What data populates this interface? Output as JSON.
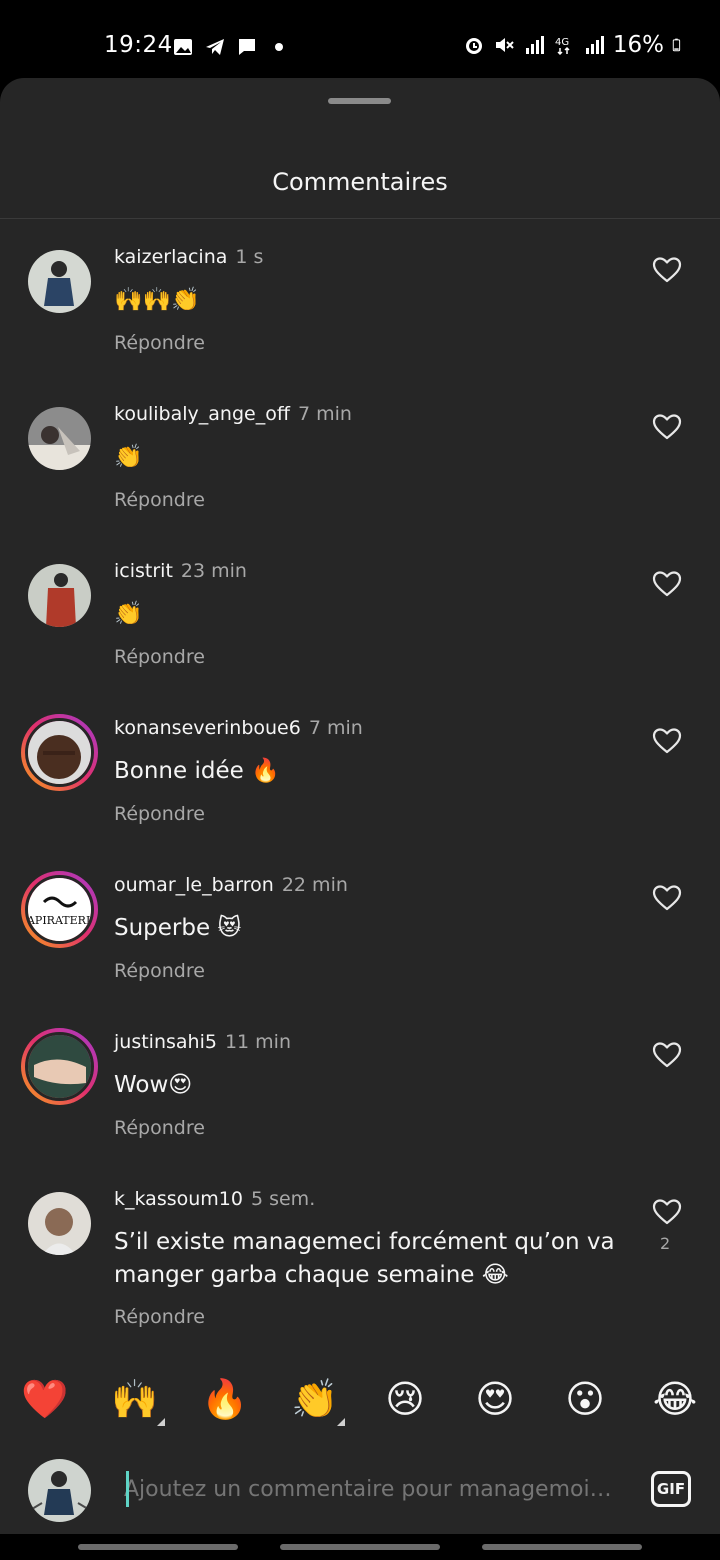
{
  "status_bar": {
    "time": "19:24",
    "left_icons": [
      "image-icon",
      "telegram-icon",
      "message-icon",
      "dot-icon"
    ],
    "right_icons": [
      "alarm-icon",
      "mute-icon",
      "signal-icon",
      "4g-icon",
      "signal-icon"
    ],
    "battery_label": "16%",
    "battery_level": 0.16
  },
  "sheet": {
    "title": "Commentaires"
  },
  "comments": [
    {
      "username": "kaizerlacina",
      "time": "1 s",
      "text": "🙌🙌👏",
      "reply_label": "Répondre",
      "likes": "",
      "story_ring": false
    },
    {
      "username": "koulibaly_ange_off",
      "time": "7 min",
      "text": "👏",
      "reply_label": "Répondre",
      "likes": "",
      "story_ring": false
    },
    {
      "username": "icistrit",
      "time": "23 min",
      "text": "👏",
      "reply_label": "Répondre",
      "likes": "",
      "story_ring": false
    },
    {
      "username": "konanseverinboue6",
      "time": "7 min",
      "text": "Bonne idée 🔥",
      "reply_label": "Répondre",
      "likes": "",
      "story_ring": true
    },
    {
      "username": "oumar_le_barron",
      "time": "22 min",
      "text": "Superbe 😻",
      "reply_label": "Répondre",
      "likes": "",
      "story_ring": true
    },
    {
      "username": "justinsahi5",
      "time": "11 min",
      "text": "Wow😍",
      "reply_label": "Répondre",
      "likes": "",
      "story_ring": true
    },
    {
      "username": "k_kassoum10",
      "time": "5 sem.",
      "text": "S’il existe managemeci forcément qu’on va manger garba chaque semaine 😂",
      "reply_label": "Répondre",
      "likes": "2",
      "story_ring": false
    }
  ],
  "reactions": [
    "❤️",
    "🙌",
    "🔥",
    "👏",
    "😢",
    "😍",
    "😮",
    "😂"
  ],
  "composer": {
    "placeholder": "Ajoutez un commentaire pour managemoici...",
    "gif_label": "GIF"
  },
  "colors": {
    "background": "#262626",
    "text": "#f5f5f5",
    "muted": "#a8a8a8",
    "story_ring_start": "#f9a11b",
    "story_ring_end": "#a33ad0",
    "caret": "#5fd4c6"
  }
}
